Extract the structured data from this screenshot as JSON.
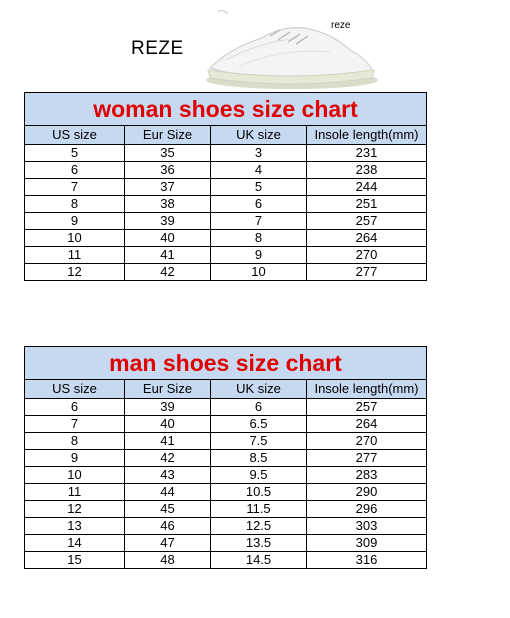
{
  "header": {
    "brand": "REZE",
    "shoe_label": "reze",
    "shoe_image": "white-knit-sneaker-icon"
  },
  "woman": {
    "title": "woman shoes size chart",
    "columns": [
      "US size",
      "Eur Size",
      "UK size",
      "Insole length(mm)"
    ],
    "rows": [
      [
        "5",
        "35",
        "3",
        "231"
      ],
      [
        "6",
        "36",
        "4",
        "238"
      ],
      [
        "7",
        "37",
        "5",
        "244"
      ],
      [
        "8",
        "38",
        "6",
        "251"
      ],
      [
        "9",
        "39",
        "7",
        "257"
      ],
      [
        "10",
        "40",
        "8",
        "264"
      ],
      [
        "11",
        "41",
        "9",
        "270"
      ],
      [
        "12",
        "42",
        "10",
        "277"
      ]
    ]
  },
  "man": {
    "title": "man shoes size chart",
    "columns": [
      "US size",
      "Eur Size",
      "UK size",
      "Insole length(mm)"
    ],
    "rows": [
      [
        "6",
        "39",
        "6",
        "257"
      ],
      [
        "7",
        "40",
        "6.5",
        "264"
      ],
      [
        "8",
        "41",
        "7.5",
        "270"
      ],
      [
        "9",
        "42",
        "8.5",
        "277"
      ],
      [
        "10",
        "43",
        "9.5",
        "283"
      ],
      [
        "11",
        "44",
        "10.5",
        "290"
      ],
      [
        "12",
        "45",
        "11.5",
        "296"
      ],
      [
        "13",
        "46",
        "12.5",
        "303"
      ],
      [
        "14",
        "47",
        "13.5",
        "309"
      ],
      [
        "15",
        "48",
        "14.5",
        "316"
      ]
    ]
  },
  "colors": {
    "header_bg": "#c6d9f1",
    "title_red": "#e00000"
  }
}
